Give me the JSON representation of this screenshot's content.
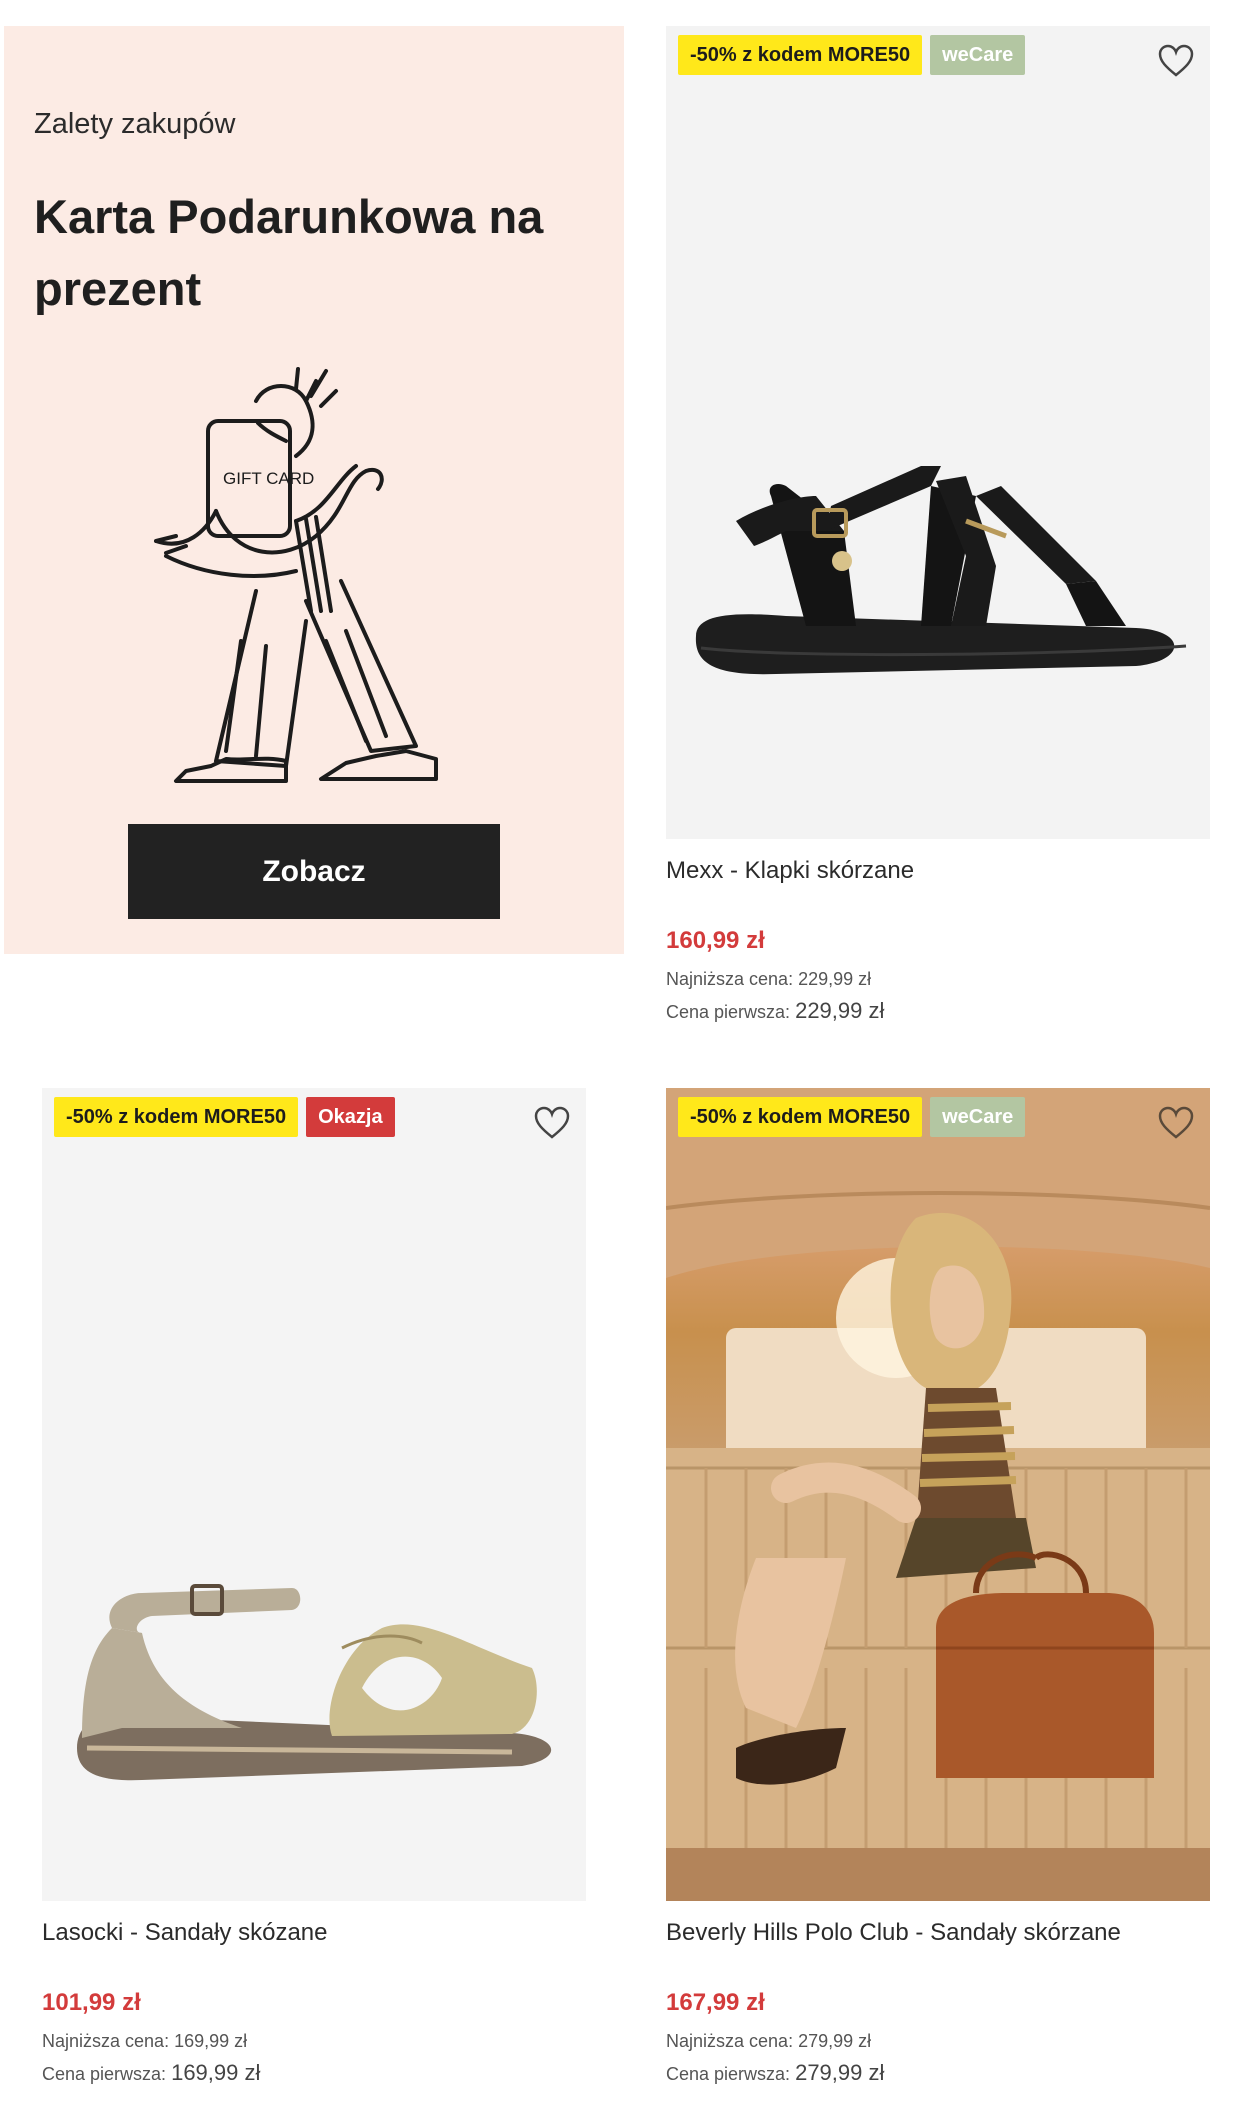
{
  "promo": {
    "kicker": "Zalety zakupów",
    "title": "Karta Podarunkowa na prezent",
    "illustration_text": "GIFT CARD",
    "cta_label": "Zobacz",
    "background": "#fcebe4"
  },
  "products": [
    {
      "badges": [
        "-50% z kodem MORE50",
        "weCare"
      ],
      "name": "Mexx - Klapki skórzane",
      "price": "160,99 zł",
      "lowest_label": "Najniższa cena:",
      "lowest_value": "229,99 zł",
      "first_label": "Cena pierwsza:",
      "first_value": "229,99 zł",
      "image_icon": "black-leather-sandal-image"
    },
    {
      "badges": [
        "-50% z kodem MORE50",
        "Okazja"
      ],
      "name": "Lasocki - Sandały skózane",
      "price": "101,99 zł",
      "lowest_label": "Najniższa cena:",
      "lowest_value": "169,99 zł",
      "first_label": "Cena pierwsza:",
      "first_value": "169,99 zł",
      "image_icon": "beige-gold-sandal-image"
    },
    {
      "badges": [
        "-50% z kodem MORE50",
        "weCare"
      ],
      "name": "Beverly Hills Polo Club - Sandały skórzane",
      "price": "167,99 zł",
      "lowest_label": "Najniższa cena:",
      "lowest_value": "279,99 zł",
      "first_label": "Cena pierwsza:",
      "first_value": "279,99 zł",
      "image_icon": "model-in-car-photo"
    }
  ],
  "colors": {
    "promo_badge": "#ffe81a",
    "wecare_badge": "#b3c6a2",
    "okazja_badge": "#d33b3b",
    "price": "#d33b3b",
    "cta": "#222222"
  }
}
